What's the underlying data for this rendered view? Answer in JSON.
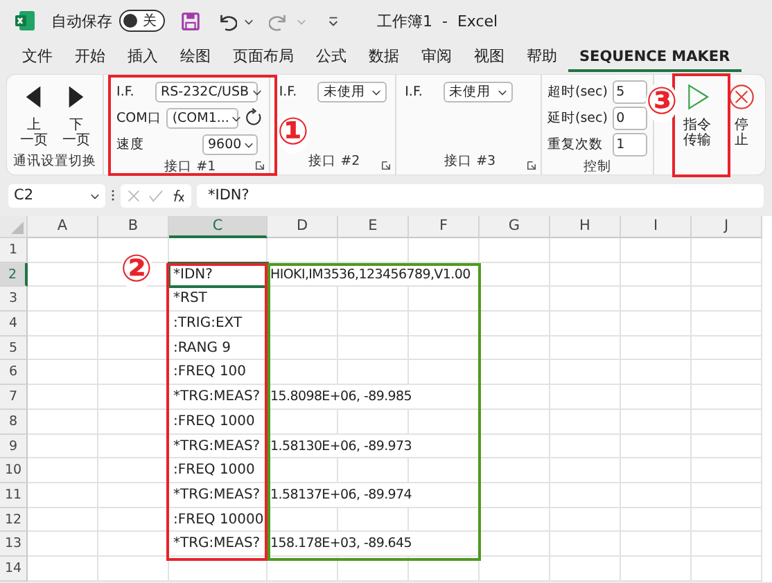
{
  "title_bar": {
    "autosave_label": "自动保存",
    "autosave_toggle": {
      "label": "关",
      "on": false
    },
    "title": "工作簿1  -  Excel"
  },
  "menu_tabs": [
    {
      "label": "文件",
      "selected": false
    },
    {
      "label": "开始",
      "selected": false
    },
    {
      "label": "插入",
      "selected": false
    },
    {
      "label": "绘图",
      "selected": false
    },
    {
      "label": "页面布局",
      "selected": false
    },
    {
      "label": "公式",
      "selected": false
    },
    {
      "label": "数据",
      "selected": false
    },
    {
      "label": "审阅",
      "selected": false
    },
    {
      "label": "视图",
      "selected": false
    },
    {
      "label": "帮助",
      "selected": false
    },
    {
      "label": "SEQUENCE MAKER",
      "selected": true
    }
  ],
  "ribbon": {
    "groups": [
      {
        "kind": "nav",
        "label": "通讯设置切换",
        "buttons": [
          {
            "kind": "left",
            "lines": [
              "上",
              "一页"
            ]
          },
          {
            "kind": "right",
            "lines": [
              "下",
              "一页"
            ]
          }
        ]
      },
      {
        "kind": "interface",
        "label": "接口 #1",
        "rows": [
          {
            "label": "I.F.",
            "value": "RS-232C/USB",
            "refresh": false
          },
          {
            "label": "COM口",
            "value": "(COM1...",
            "refresh": true
          },
          {
            "label": "速度",
            "value": "9600",
            "refresh": false
          }
        ]
      },
      {
        "kind": "interface",
        "label": "接口 #2",
        "rows": [
          {
            "label": "I.F.",
            "value": "未使用",
            "refresh": false
          }
        ]
      },
      {
        "kind": "interface",
        "label": "接口 #3",
        "rows": [
          {
            "label": "I.F.",
            "value": "未使用",
            "refresh": false
          }
        ]
      },
      {
        "kind": "control",
        "label": "控制",
        "rows": [
          {
            "label": "超时(sec)",
            "value": "5"
          },
          {
            "label": "延时(sec)",
            "value": "0"
          },
          {
            "label": "重复次数",
            "value": "1"
          }
        ]
      },
      {
        "kind": "actions",
        "buttons": [
          {
            "kind": "send",
            "lines": [
              "指令",
              "传输"
            ]
          },
          {
            "kind": "stop",
            "lines": [
              "停",
              "止"
            ]
          }
        ]
      }
    ]
  },
  "formula_bar": {
    "name_box": "C2",
    "formula": "*IDN?"
  },
  "sheet": {
    "columns": [
      {
        "label": "A",
        "selected": false
      },
      {
        "label": "B",
        "selected": false
      },
      {
        "label": "C",
        "selected": true
      },
      {
        "label": "D",
        "selected": false
      },
      {
        "label": "E",
        "selected": false
      },
      {
        "label": "F",
        "selected": false
      },
      {
        "label": "G",
        "selected": false
      },
      {
        "label": "H",
        "selected": false
      },
      {
        "label": "I",
        "selected": false
      },
      {
        "label": "J",
        "selected": false
      }
    ],
    "rows": [
      {
        "label": "1",
        "selected": false
      },
      {
        "label": "2",
        "selected": true,
        "command": "*IDN?",
        "response": "HIOKI,IM3536,123456789,V1.00"
      },
      {
        "label": "3",
        "selected": false,
        "command": "*RST"
      },
      {
        "label": "4",
        "selected": false,
        "command": ":TRIG:EXT"
      },
      {
        "label": "5",
        "selected": false,
        "command": ":RANG 9"
      },
      {
        "label": "6",
        "selected": false,
        "command": ":FREQ 100"
      },
      {
        "label": "7",
        "selected": false,
        "command": "*TRG:MEAS?",
        "response": "15.8098E+06, -89.985"
      },
      {
        "label": "8",
        "selected": false,
        "command": ":FREQ 1000"
      },
      {
        "label": "9",
        "selected": false,
        "command": "*TRG:MEAS?",
        "response": "1.58130E+06, -89.973"
      },
      {
        "label": "10",
        "selected": false,
        "command": ":FREQ 1000"
      },
      {
        "label": "11",
        "selected": false,
        "command": "*TRG:MEAS?",
        "response": "1.58137E+06, -89.974"
      },
      {
        "label": "12",
        "selected": false,
        "command": ":FREQ 10000"
      },
      {
        "label": "13",
        "selected": false,
        "command": "*TRG:MEAS?",
        "response": "158.178E+03, -89.645"
      },
      {
        "label": "14",
        "selected": false
      }
    ]
  },
  "annotations": [
    {
      "kind": "box",
      "color": "#e8232a"
    },
    {
      "kind": "marker",
      "label": "①"
    },
    {
      "kind": "box",
      "color": "#e8232a"
    },
    {
      "kind": "marker",
      "label": "②"
    },
    {
      "kind": "box",
      "color": "#4e9a1e"
    },
    {
      "kind": "box",
      "color": "#e8232a"
    },
    {
      "kind": "marker",
      "label": "③"
    }
  ]
}
